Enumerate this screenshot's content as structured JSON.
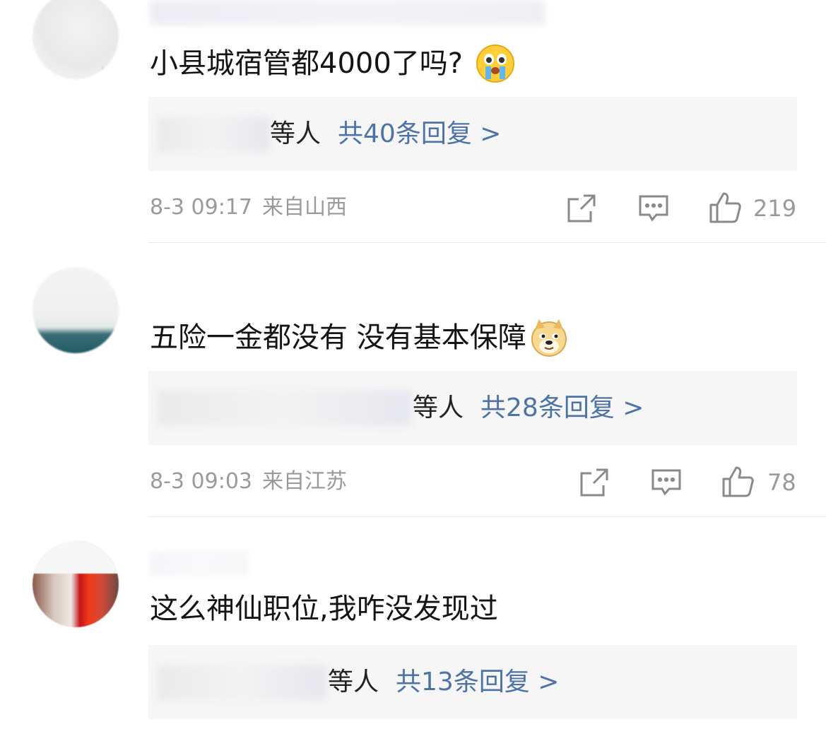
{
  "comments": [
    {
      "text": "小县城宿管都4000了吗?",
      "emoji": "crying-face-icon",
      "reply_suffix": "等人",
      "reply_count": "共40条回复 >",
      "time": "8-3 09:17",
      "location": "来自山西",
      "likes": "219"
    },
    {
      "text": "五险一金都没有 没有基本保障",
      "emoji": "doge-icon",
      "reply_suffix": "等人",
      "reply_count": "共28条回复 >",
      "time": "8-3 09:03",
      "location": "来自江苏",
      "likes": "78"
    },
    {
      "text": "这么神仙职位,我咋没发现过",
      "reply_suffix": "等人",
      "reply_count": "共13条回复 >"
    }
  ],
  "colors": {
    "link": "#4d73a6",
    "meta": "#9a9a9a",
    "reply_bg": "#f6f6f6"
  }
}
